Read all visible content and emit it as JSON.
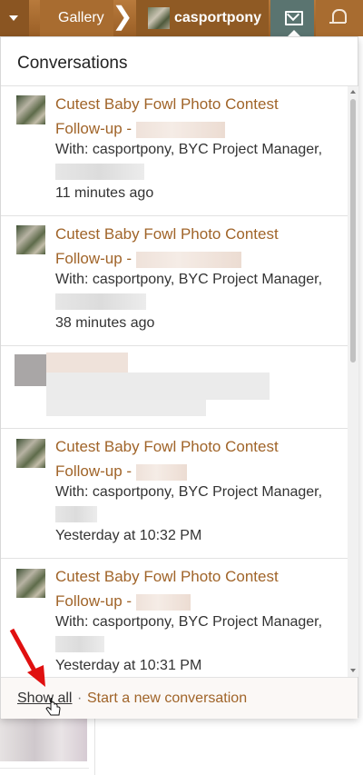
{
  "nav": {
    "gallery_label": "Gallery",
    "chevron": "❯",
    "username": "casportpony",
    "icons": {
      "dropdown": "caret-down-icon",
      "mail": "envelope-icon",
      "bell": "bell-icon"
    }
  },
  "popup": {
    "title": "Conversations",
    "conversations": [
      {
        "title": "Cutest Baby Fowl Photo Contest Follow-up -",
        "with": "With: casportpony, BYC Project Manager,",
        "time": "11 minutes ago"
      },
      {
        "title": "Cutest Baby Fowl Photo Contest Follow-up -",
        "with": "With: casportpony, BYC Project Manager,",
        "time": "38 minutes ago"
      },
      {
        "title": "",
        "with": "",
        "time": ""
      },
      {
        "title": "Cutest Baby Fowl Photo Contest Follow-up -",
        "with": "With: casportpony, BYC Project Manager,",
        "time": "Yesterday at 10:32 PM"
      },
      {
        "title": "Cutest Baby Fowl Photo Contest Follow-up -",
        "with": "With: casportpony, BYC Project Manager,",
        "time": "Yesterday at 10:31 PM"
      }
    ],
    "footer": {
      "show_all": "Show all",
      "separator": "·",
      "start_new": "Start a new conversation"
    }
  },
  "colors": {
    "accent": "#a06429",
    "nav": "#a86c30",
    "mail_active": "#5a7470",
    "arrow": "#e01010"
  }
}
